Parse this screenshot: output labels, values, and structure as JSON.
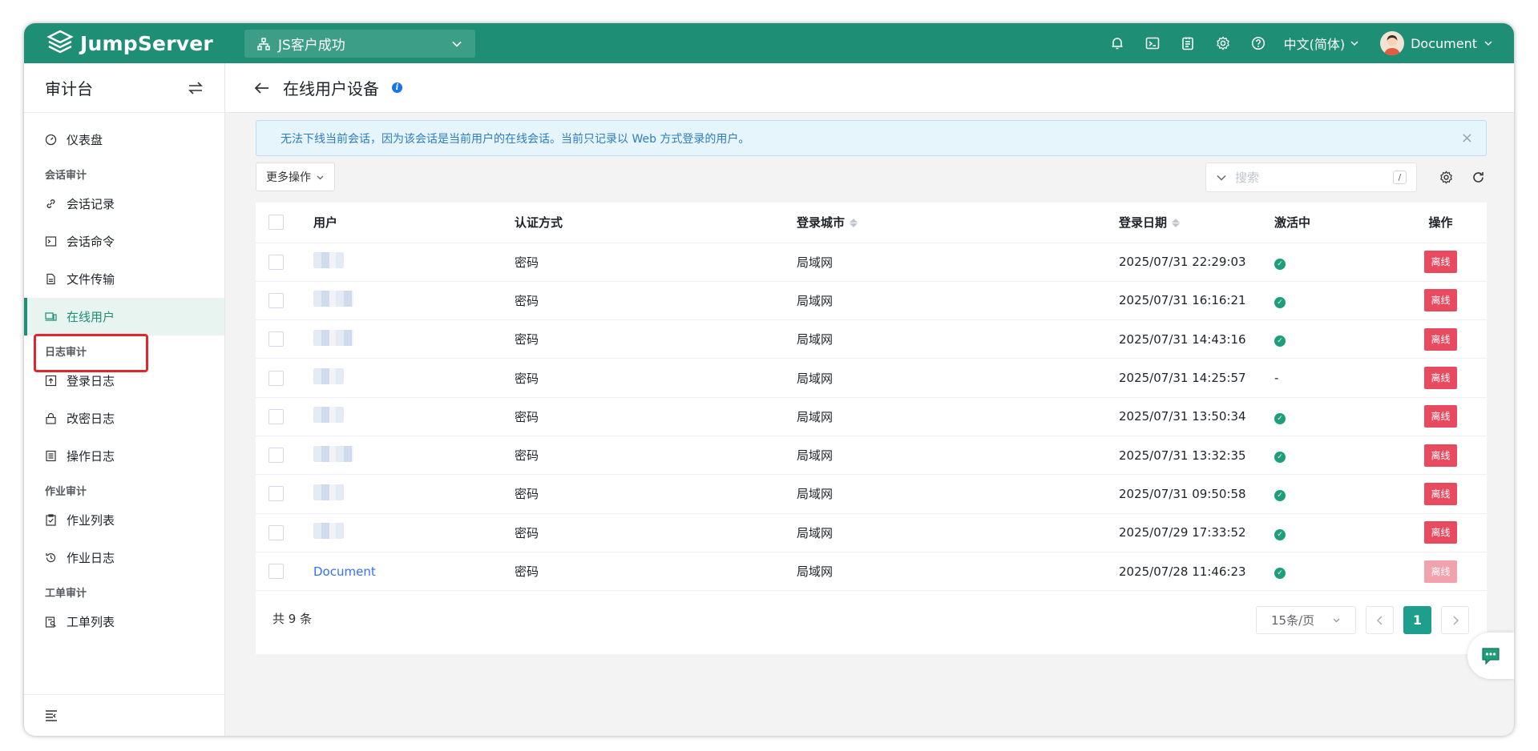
{
  "app": {
    "logo_text": "JumpServer",
    "org": "JS客户成功",
    "language": "中文(简体)",
    "username": "Document"
  },
  "sidebar": {
    "title": "审计台",
    "items": {
      "dashboard": "仪表盘",
      "session_audit_group": "会话审计",
      "session_records": "会话记录",
      "session_commands": "会话命令",
      "file_transfer": "文件传输",
      "online_users": "在线用户",
      "log_audit_group": "日志审计",
      "login_logs": "登录日志",
      "password_change_logs": "改密日志",
      "operation_logs": "操作日志",
      "job_audit_group": "作业审计",
      "job_list": "作业列表",
      "job_logs": "作业日志",
      "ticket_audit_group": "工单审计",
      "ticket_list": "工单列表"
    }
  },
  "page": {
    "title": "在线用户设备",
    "alert": "无法下线当前会话，因为该会话是当前用户的在线会话。当前只记录以 Web 方式登录的用户。",
    "more_actions": "更多操作",
    "search_placeholder": "搜索",
    "search_shortcut": "/"
  },
  "table": {
    "columns": {
      "user": "用户",
      "auth_method": "认证方式",
      "city": "登录城市",
      "date": "登录日期",
      "active": "激活中",
      "actions": "操作"
    },
    "rows": [
      {
        "user": "",
        "auth": "密码",
        "city": "局域网",
        "date": "2025/07/31 22:29:03",
        "active": "✓",
        "action": "离线"
      },
      {
        "user": "",
        "auth": "密码",
        "city": "局域网",
        "date": "2025/07/31 16:16:21",
        "active": "✓",
        "action": "离线"
      },
      {
        "user": "",
        "auth": "密码",
        "city": "局域网",
        "date": "2025/07/31 14:43:16",
        "active": "✓",
        "action": "离线"
      },
      {
        "user": "",
        "auth": "密码",
        "city": "局域网",
        "date": "2025/07/31 14:25:57",
        "active": "-",
        "action": "离线"
      },
      {
        "user": "",
        "auth": "密码",
        "city": "局域网",
        "date": "2025/07/31 13:50:34",
        "active": "✓",
        "action": "离线"
      },
      {
        "user": "",
        "auth": "密码",
        "city": "局域网",
        "date": "2025/07/31 13:32:35",
        "active": "✓",
        "action": "离线"
      },
      {
        "user": "",
        "auth": "密码",
        "city": "局域网",
        "date": "2025/07/31 09:50:58",
        "active": "✓",
        "action": "离线"
      },
      {
        "user": "",
        "auth": "密码",
        "city": "局域网",
        "date": "2025/07/29 17:33:52",
        "active": "✓",
        "action": "离线"
      },
      {
        "user": "Document",
        "auth": "密码",
        "city": "局域网",
        "date": "2025/07/28 11:46:23",
        "active": "✓",
        "action": "离线"
      }
    ],
    "total": "共 9 条",
    "page_size": "15条/页",
    "current_page": "1"
  },
  "colors": {
    "brand": "#1e8e75",
    "danger": "#e84a5f",
    "link": "#3370ff"
  }
}
